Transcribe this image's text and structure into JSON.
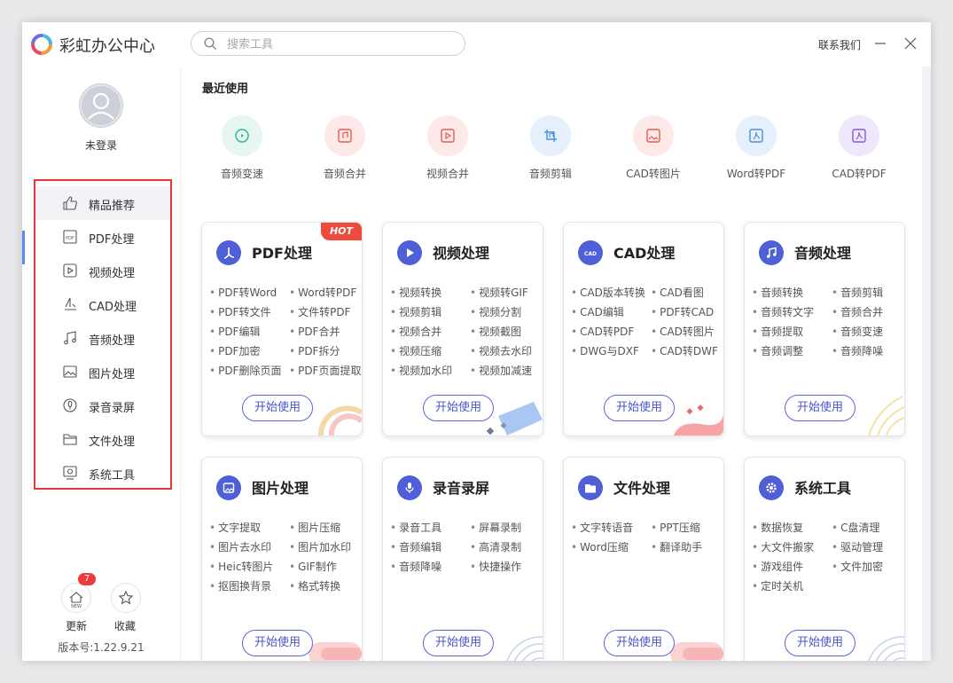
{
  "app": {
    "title": "彩虹办公中心",
    "contact": "联系我们"
  },
  "search": {
    "placeholder": "搜索工具"
  },
  "user": {
    "status": "未登录"
  },
  "sidebar": {
    "items": [
      {
        "label": "精品推荐",
        "icon": "thumbs-up-icon"
      },
      {
        "label": "PDF处理",
        "icon": "pdf-icon"
      },
      {
        "label": "视频处理",
        "icon": "video-play-icon"
      },
      {
        "label": "CAD处理",
        "icon": "cad-icon"
      },
      {
        "label": "音频处理",
        "icon": "music-note-icon"
      },
      {
        "label": "图片处理",
        "icon": "image-icon"
      },
      {
        "label": "录音录屏",
        "icon": "microphone-icon"
      },
      {
        "label": "文件处理",
        "icon": "folder-icon"
      },
      {
        "label": "系统工具",
        "icon": "system-tool-icon"
      }
    ],
    "active_index": 0,
    "update_label": "更新",
    "update_badge": "7",
    "favorites_label": "收藏",
    "version": "版本号:1.22.9.21"
  },
  "recent": {
    "title": "最近使用",
    "items": [
      {
        "label": "音频变速",
        "color": "#2bb58f",
        "bg": "#e6f6f1"
      },
      {
        "label": "音频合并",
        "color": "#ea5a50",
        "bg": "#fde9e7"
      },
      {
        "label": "视频合并",
        "color": "#ea5a50",
        "bg": "#fde9e7"
      },
      {
        "label": "音频剪辑",
        "color": "#4a8fe0",
        "bg": "#e6f0fc"
      },
      {
        "label": "CAD转图片",
        "color": "#ea5a50",
        "bg": "#fde9e7"
      },
      {
        "label": "Word转PDF",
        "color": "#4a8fe0",
        "bg": "#e6f0fc"
      },
      {
        "label": "CAD转PDF",
        "color": "#8a5ad8",
        "bg": "#efe7fb"
      }
    ]
  },
  "cards": [
    {
      "title": "PDF处理",
      "hot": "HOT",
      "icon": "pdf-icon",
      "items": [
        "PDF转Word",
        "Word转PDF",
        "PDF转文件",
        "文件转PDF",
        "PDF编辑",
        "PDF合并",
        "PDF加密",
        "PDF拆分",
        "PDF删除页面",
        "PDF页面提取"
      ],
      "button": "开始使用"
    },
    {
      "title": "视频处理",
      "icon": "video-play-icon",
      "items": [
        "视频转换",
        "视频转GIF",
        "视频剪辑",
        "视频分割",
        "视频合并",
        "视频截图",
        "视频压缩",
        "视频去水印",
        "视频加水印",
        "视频加减速"
      ],
      "button": "开始使用"
    },
    {
      "title": "CAD处理",
      "icon": "cad-icon",
      "items": [
        "CAD版本转换",
        "CAD看图",
        "CAD编辑",
        "PDF转CAD",
        "CAD转PDF",
        "CAD转图片",
        "DWG与DXF",
        "CAD转DWF"
      ],
      "button": "开始使用"
    },
    {
      "title": "音频处理",
      "icon": "music-note-icon",
      "items": [
        "音频转换",
        "音频剪辑",
        "音频转文字",
        "音频合并",
        "音频提取",
        "音频变速",
        "音频调整",
        "音频降噪"
      ],
      "button": "开始使用"
    },
    {
      "title": "图片处理",
      "icon": "image-icon",
      "items": [
        "文字提取",
        "图片压缩",
        "图片去水印",
        "图片加水印",
        "Heic转图片",
        "GIF制作",
        "抠图换背景",
        "格式转换"
      ],
      "button": "开始使用"
    },
    {
      "title": "录音录屏",
      "icon": "microphone-icon",
      "items": [
        "录音工具",
        "屏幕录制",
        "音频编辑",
        "高清录制",
        "音频降噪",
        "快捷操作"
      ],
      "button": "开始使用"
    },
    {
      "title": "文件处理",
      "icon": "folder-icon",
      "items": [
        "文字转语音",
        "PPT压缩",
        "Word压缩",
        "翻译助手"
      ],
      "button": "开始使用"
    },
    {
      "title": "系统工具",
      "icon": "gear-icon",
      "items": [
        "数据恢复",
        "C盘清理",
        "大文件搬家",
        "驱动管理",
        "游戏组件",
        "文件加密",
        "定时关机"
      ],
      "button": "开始使用"
    }
  ],
  "colors": {
    "accent": "#4e5fd8",
    "highlight_border": "#e8373b",
    "hot": "#ee4b3d"
  }
}
